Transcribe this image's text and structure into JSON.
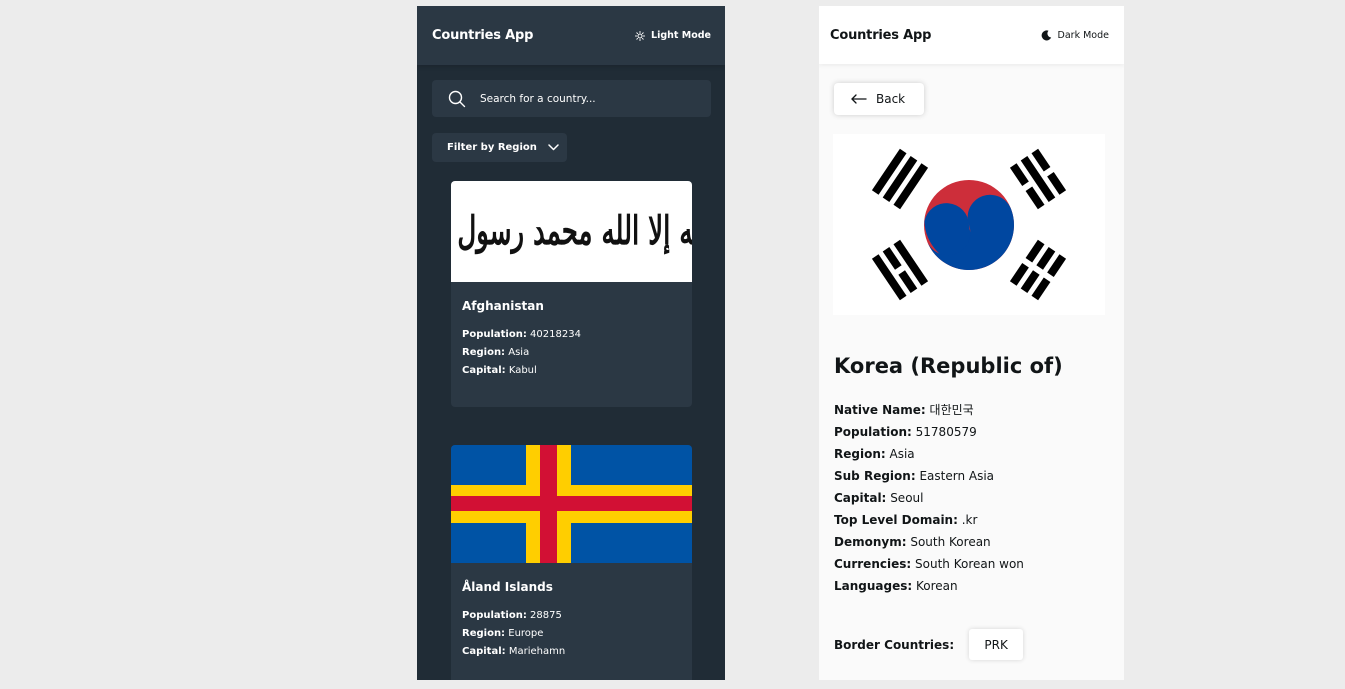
{
  "dark_view": {
    "app_title": "Countries App",
    "mode_label": "Light Mode",
    "search": {
      "placeholder": "Search for a country..."
    },
    "filter_label": "Filter by Region",
    "cards": [
      {
        "name": "Afghanistan",
        "population_label": "Population:",
        "population": "40218234",
        "region_label": "Region:",
        "region": "Asia",
        "capital_label": "Capital:",
        "capital": "Kabul",
        "flag_text": "لا إله إلا الله محمد رسول الله"
      },
      {
        "name": "Åland Islands",
        "population_label": "Population:",
        "population": "28875",
        "region_label": "Region:",
        "region": "Europe",
        "capital_label": "Capital:",
        "capital": "Mariehamn"
      }
    ]
  },
  "light_view": {
    "app_title": "Countries App",
    "mode_label": "Dark Mode",
    "back_label": "Back",
    "country_name": "Korea (Republic of)",
    "details": [
      {
        "label": "Native Name:",
        "value": "대한민국"
      },
      {
        "label": "Population:",
        "value": "51780579"
      },
      {
        "label": "Region:",
        "value": "Asia"
      },
      {
        "label": "Sub Region:",
        "value": "Eastern Asia"
      },
      {
        "label": "Capital:",
        "value": "Seoul"
      },
      {
        "label": "Top Level Domain:",
        "value": ".kr"
      },
      {
        "label": "Demonym:",
        "value": "South Korean"
      },
      {
        "label": "Currencies:",
        "value": "South Korean won"
      },
      {
        "label": "Languages:",
        "value": "Korean"
      }
    ],
    "border_label": "Border Countries:",
    "border_countries": [
      "PRK"
    ]
  },
  "colors": {
    "dark_bg": "#202c36",
    "dark_element": "#2b3844",
    "light_bg": "#fafafa",
    "korea_red": "#cd2e3a",
    "korea_blue": "#0047a0",
    "aland_blue": "#0053a5",
    "aland_yellow": "#ffce00",
    "aland_red": "#d21034"
  }
}
